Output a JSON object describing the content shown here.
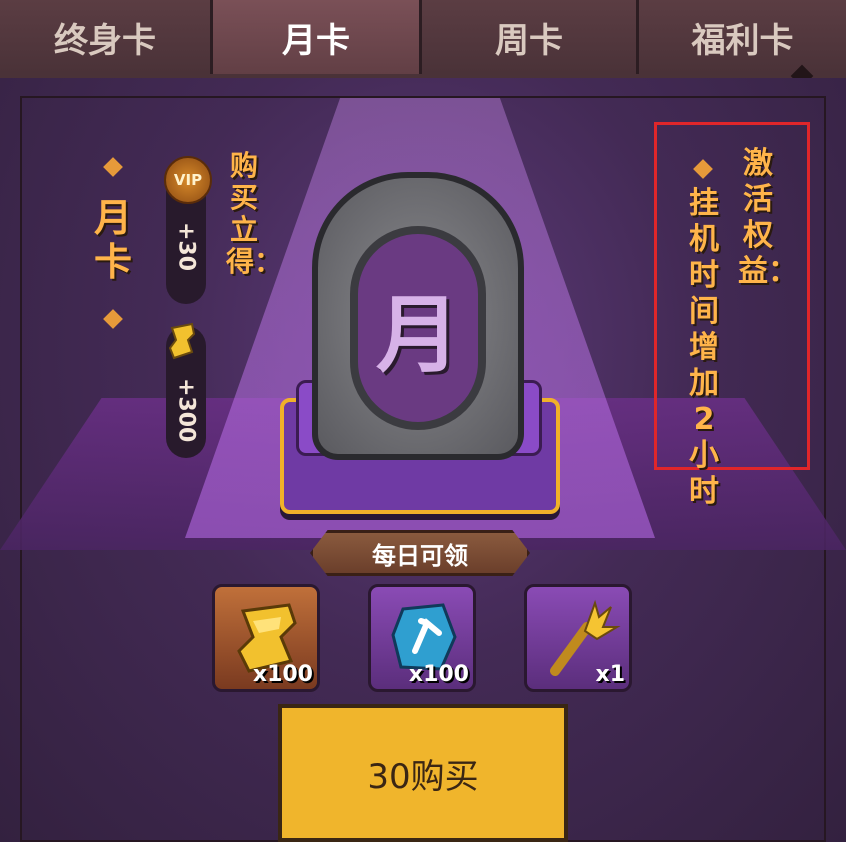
{
  "tabs": [
    {
      "label": "终身卡",
      "active": false
    },
    {
      "label": "月卡",
      "active": true
    },
    {
      "label": "周卡",
      "active": false
    },
    {
      "label": "福利卡",
      "active": false
    }
  ],
  "card": {
    "title": "月卡",
    "emblem_char": "月"
  },
  "instant_rewards": {
    "label": "购买立得：",
    "vip_badge": "VIP",
    "vip_value": "+30",
    "gold_value": "+300"
  },
  "benefits": {
    "title": "激活权益：",
    "text": "挂机时间增加2小时"
  },
  "daily": {
    "label": "每日可领",
    "items": [
      {
        "icon": "gold-ingot-icon",
        "count": "x100"
      },
      {
        "icon": "blue-rune-stone-icon",
        "count": "x100"
      },
      {
        "icon": "golden-scepter-icon",
        "count": "x1"
      }
    ]
  },
  "buy_button": {
    "label": "30购买"
  },
  "colors": {
    "accent_orange": "#ffb44a",
    "highlight_box": "#e0262a",
    "button_gold": "#f0b52c"
  }
}
